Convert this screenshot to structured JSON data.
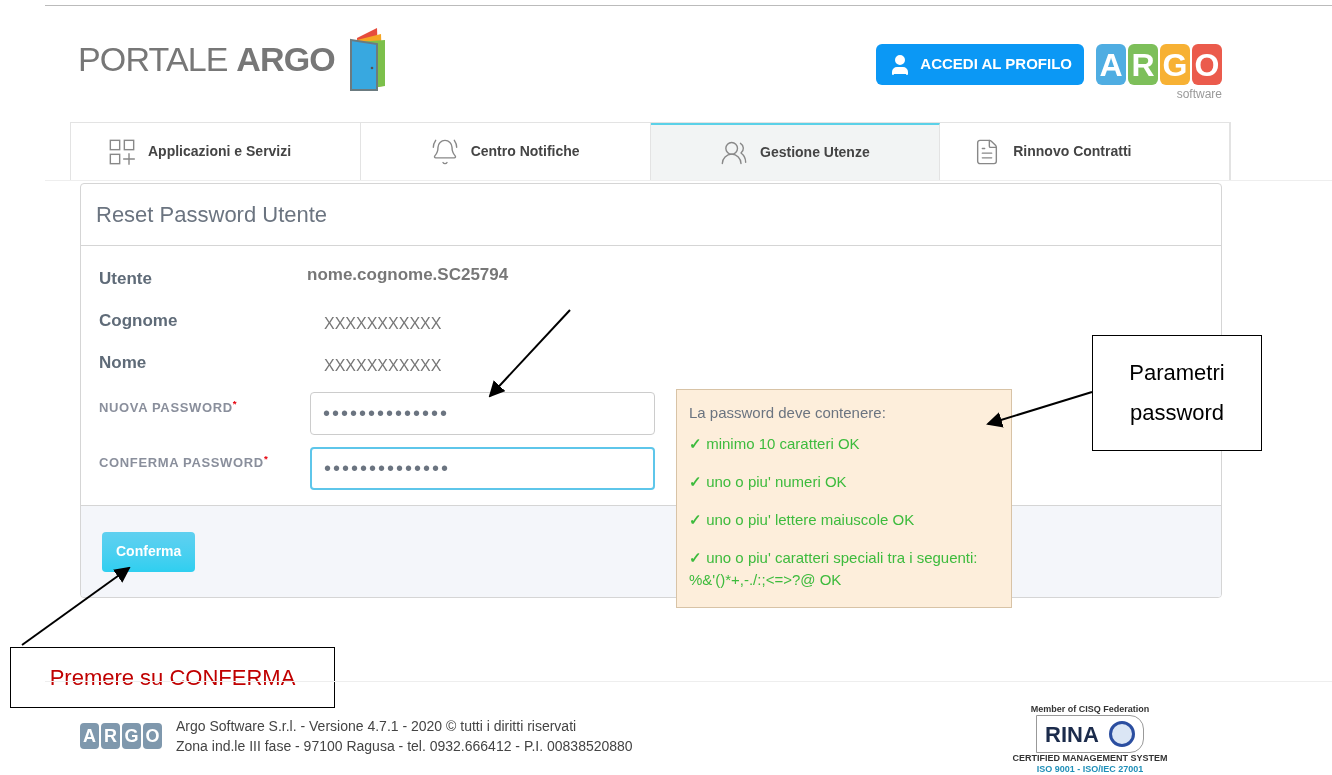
{
  "header": {
    "logo_light": "PORTALE",
    "logo_bold": "ARGO",
    "profile_button": "ACCEDI AL PROFILO",
    "brand_letters": [
      {
        "letter": "A",
        "color": "#4fade2"
      },
      {
        "letter": "R",
        "color": "#7dbf5a"
      },
      {
        "letter": "G",
        "color": "#f7b134"
      },
      {
        "letter": "O",
        "color": "#eb5b4c"
      }
    ],
    "brand_sub": "software"
  },
  "tabs": [
    {
      "label": "Applicazioni e Servizi",
      "selected": false
    },
    {
      "label": "Centro Notifiche",
      "selected": false
    },
    {
      "label": "Gestione Utenze",
      "selected": true
    },
    {
      "label": "Rinnovo Contratti",
      "selected": false
    }
  ],
  "card": {
    "title": "Reset Password Utente",
    "info": [
      {
        "label": "Utente",
        "value": "nome.cognome.SC25794"
      },
      {
        "label": "Cognome",
        "value": "XXXXXXXXXXX"
      },
      {
        "label": "Nome",
        "value": "XXXXXXXXXXX"
      }
    ],
    "fields": [
      {
        "label": "NUOVA PASSWORD",
        "required_mark": "*",
        "value": "••••••••••••••",
        "focused": false
      },
      {
        "label": "CONFERMA PASSWORD",
        "required_mark": "*",
        "value": "••••••••••••••",
        "focused": true
      }
    ],
    "confirm_button": "Conferma"
  },
  "tooltip": {
    "title": "La password deve contenere:",
    "rules": [
      {
        "check": "✓",
        "text": "minimo 10 caratteri OK"
      },
      {
        "check": "✓",
        "text": "uno o piu' numeri OK"
      },
      {
        "check": "✓",
        "text": "uno o piu' lettere maiuscole OK"
      },
      {
        "check": "✓",
        "text": "uno o piu' caratteri speciali tra i seguenti:\n%&'()*+,-./:;<=>?@ OK"
      }
    ]
  },
  "callouts": {
    "password_params": "Parametri password",
    "press_confirm": "Premere su CONFERMA"
  },
  "footer": {
    "logo_letters": [
      "A",
      "R",
      "G",
      "O"
    ],
    "lines": [
      "Argo Software S.r.l. - Versione 4.7.1 - 2020 © tutti i diritti riservati",
      "Zona ind.le III fase - 97100 Ragusa - tel. 0932.666412 - P.I. 00838520880"
    ],
    "certification": {
      "top": "Member of CISQ Federation",
      "name": "RINA",
      "caption": "CERTIFIED MANAGEMENT SYSTEM",
      "standards": "ISO 9001 - ISO/IEC 27001"
    }
  }
}
